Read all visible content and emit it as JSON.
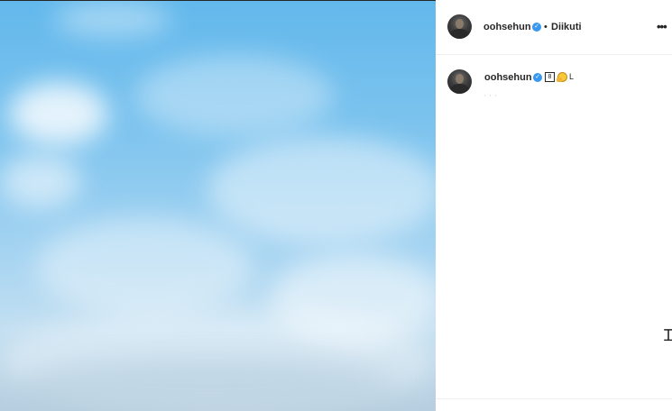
{
  "post": {
    "author": {
      "username": "oohsehun",
      "verified": true,
      "follow_status": "Diikuti"
    },
    "header": {
      "separator": "•",
      "more_label": "•••"
    },
    "caption": {
      "username": "oohsehun",
      "emoji_box": "8",
      "trailing_text": "L",
      "faint_text": "' ' '"
    }
  },
  "colors": {
    "verified_badge": "#3897f0",
    "text": "#262626",
    "divider": "#efefef"
  },
  "icons": {
    "verified": "check-badge-icon",
    "more": "ellipsis-icon",
    "cursor": "text-cursor-icon"
  }
}
